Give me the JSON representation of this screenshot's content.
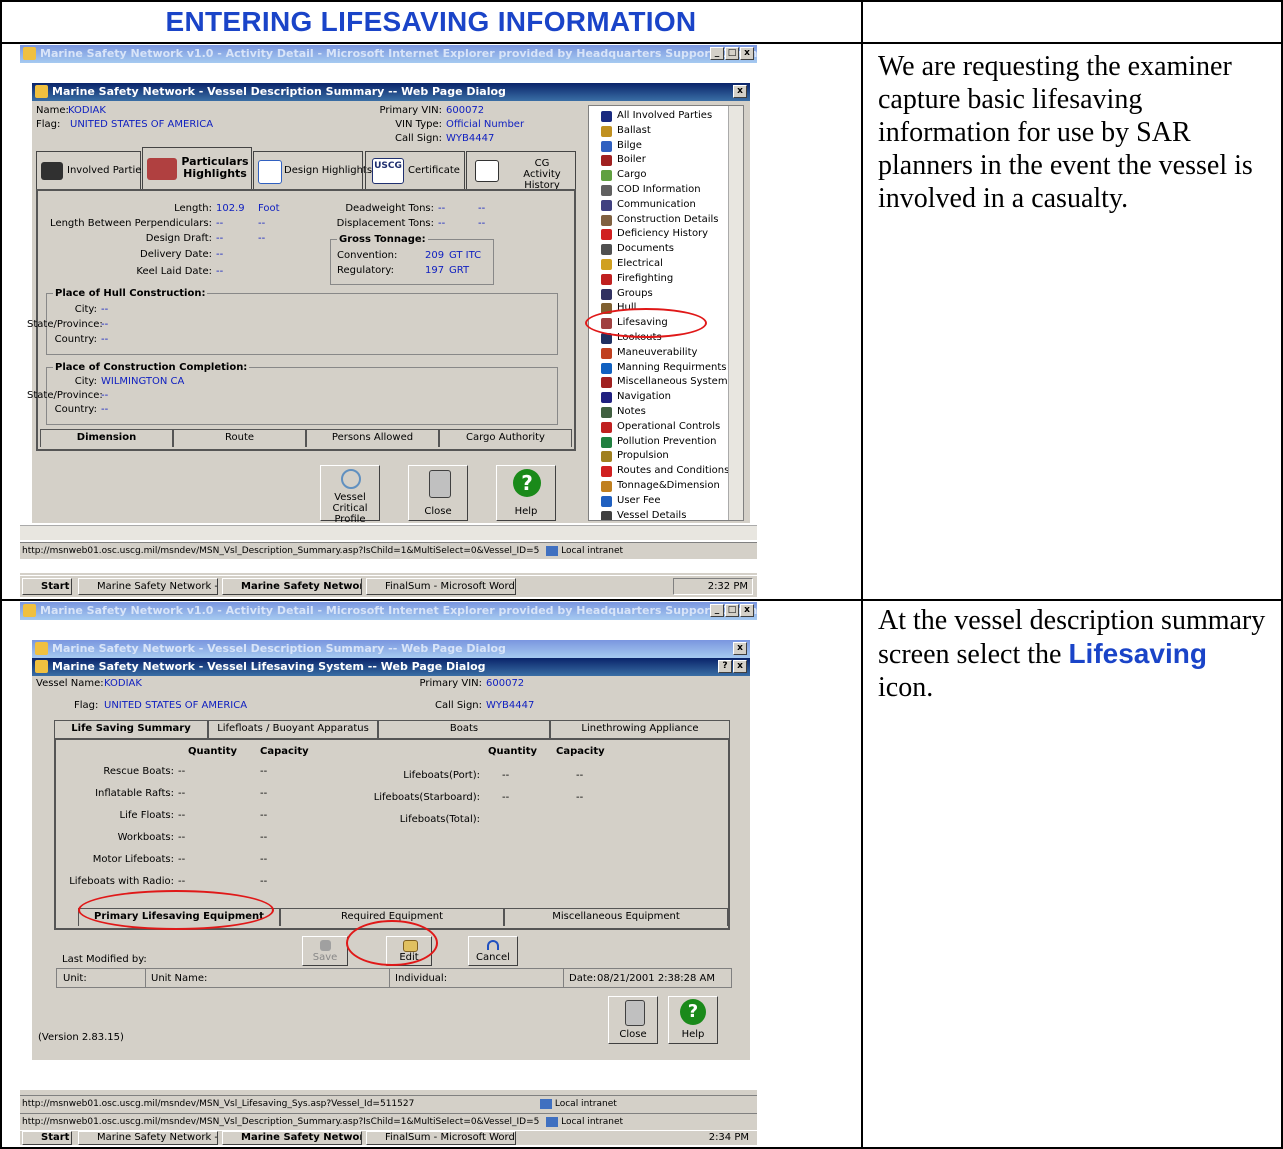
{
  "heading": "ENTERING LIFESAVING INFORMATION",
  "notes": {
    "row1": "We are requesting the examiner capture basic lifesaving information for use by SAR planners in the event the vessel is involved in a casualty.",
    "row2_before": "At the vessel description summary screen select the ",
    "row2_highlight": "Lifesaving",
    "row2_after": " icon."
  },
  "shot1": {
    "browser_title": "Marine Safety Network v1.0 - Activity Detail - Microsoft Internet Explorer provided by Headquarters Support Command",
    "dialog_title": "Marine Safety Network - Vessel Description Summary -- Web Page Dialog",
    "name_label": "Name:",
    "name_value": "KODIAK",
    "flag_label": "Flag:",
    "flag_value": "UNITED STATES OF AMERICA",
    "vin_label": "Primary VIN:",
    "vin_value": "600072",
    "vin_type_label": "VIN Type:",
    "vin_type_value": "Official Number",
    "call_sign_label": "Call Sign:",
    "call_sign_value": "WYB4447",
    "tabs": [
      "Involved Parties",
      "Particulars Highlights",
      "Design Highlights",
      "Certificate",
      "CG Activity History"
    ],
    "uscg": "USCG",
    "length_label": "Length:",
    "length_value": "102.9",
    "length_unit": "Foot",
    "lbp_label": "Length Between Perpendiculars:",
    "design_draft_label": "Design Draft:",
    "delivery_label": "Delivery Date:",
    "keel_label": "Keel Laid Date:",
    "deadweight_label": "Deadweight Tons:",
    "displacement_label": "Displacement Tons:",
    "dash": "--",
    "gross_tonnage": "Gross Tonnage:",
    "convention_label": "Convention:",
    "convention_value": "209",
    "convention_unit": "GT ITC",
    "regulatory_label": "Regulatory:",
    "regulatory_value": "197",
    "regulatory_unit": "GRT",
    "hull_group": "Place of Hull Construction:",
    "completion_group": "Place of Construction Completion:",
    "city_label": "City:",
    "state_label": "State/Province:",
    "country_label": "Country:",
    "completion_city": "WILMINGTON CA",
    "bottom_tabs": [
      "Dimension",
      "Route",
      "Persons Allowed",
      "Cargo Authority"
    ],
    "btn_vcp": "Vessel Critical Profile",
    "btn_close": "Close",
    "btn_help": "Help",
    "tree": [
      "All Involved Parties",
      "Ballast",
      "Bilge",
      "Boiler",
      "Cargo",
      "COD Information",
      "Communication",
      "Construction Details",
      "Deficiency History",
      "Documents",
      "Electrical",
      "Firefighting",
      "Groups",
      "Hull",
      "Lifesaving",
      "Lookouts",
      "Maneuverability",
      "Manning Requirments",
      "Miscellaneous System",
      "Navigation",
      "Notes",
      "Operational Controls",
      "Pollution Prevention",
      "Propulsion",
      "Routes and Conditions",
      "Tonnage&Dimension",
      "User Fee",
      "Vessel Details"
    ],
    "tree_colors": [
      "#1a2a80",
      "#c09020",
      "#3060c0",
      "#a02020",
      "#60a040",
      "#606060",
      "#404080",
      "#806040",
      "#d02020",
      "#505050",
      "#d0a020",
      "#c02020",
      "#303060",
      "#806030",
      "#a04040",
      "#203060",
      "#c04020",
      "#1060c0",
      "#a02020",
      "#202080",
      "#406040",
      "#c02020",
      "#208040",
      "#a08020",
      "#d02020",
      "#c08020",
      "#2060c0",
      "#404040"
    ],
    "status_url": "http://msnweb01.osc.uscg.mil/msndev/MSN_Vsl_Description_Summary.asp?IsChild=1&MultiSelect=0&Vessel_ID=5",
    "status_zone": "Local intranet",
    "taskbar": [
      "Start",
      "Marine Safety Network - ...",
      "Marine Safety Networ...",
      "FinalSum - Microsoft Word"
    ],
    "clock": "2:32 PM"
  },
  "shot2": {
    "browser_title": "Marine Safety Network v1.0 - Activity Detail - Microsoft Internet Explorer provided by Headquarters Support Command",
    "dialog1_title": "Marine Safety Network - Vessel Description Summary -- Web Page Dialog",
    "dialog2_title": "Marine Safety Network - Vessel Lifesaving System -- Web Page Dialog",
    "vessel_name_label": "Vessel Name:",
    "vessel_name_value": "KODIAK",
    "flag_label": "Flag:",
    "flag_value": "UNITED STATES OF AMERICA",
    "vin_label": "Primary VIN:",
    "vin_value": "600072",
    "call_sign_label": "Call Sign:",
    "call_sign_value": "WYB4447",
    "tabs": [
      "Life Saving Summary",
      "Lifefloats / Buoyant Apparatus",
      "Boats",
      "Linethrowing Appliance"
    ],
    "quantity": "Quantity",
    "capacity": "Capacity",
    "left_rows": [
      "Rescue Boats:",
      "Inflatable Rafts:",
      "Life Floats:",
      "Workboats:",
      "Motor Lifeboats:",
      "Lifeboats with Radio:"
    ],
    "right_rows": [
      "Lifeboats(Port):",
      "Lifeboats(Starboard):",
      "Lifeboats(Total):"
    ],
    "dash": "--",
    "bottom_tabs": [
      "Primary Lifesaving Equipment",
      "Required Equipment",
      "Miscellaneous Equipment"
    ],
    "btn_save": "Save",
    "btn_edit": "Edit",
    "btn_cancel": "Cancel",
    "last_modified": "Last Modified by:",
    "unit_label": "Unit:",
    "unit_name_label": "Unit Name:",
    "individual_label": "Individual:",
    "date_label": "Date:",
    "date_value": "08/21/2001 2:38:28 AM",
    "version": "(Version 2.83.15)",
    "btn_close": "Close",
    "btn_help": "Help",
    "status_url1": "http://msnweb01.osc.uscg.mil/msndev/MSN_Vsl_Lifesaving_Sys.asp?Vessel_Id=511527",
    "status_url2": "http://msnweb01.osc.uscg.mil/msndev/MSN_Vsl_Description_Summary.asp?IsChild=1&MultiSelect=0&Vessel_ID=5",
    "status_zone": "Local intranet",
    "taskbar": [
      "Start",
      "Marine Safety Network - ...",
      "Marine Safety Networ...",
      "FinalSum - Microsoft Word"
    ],
    "clock": "2:34 PM"
  }
}
